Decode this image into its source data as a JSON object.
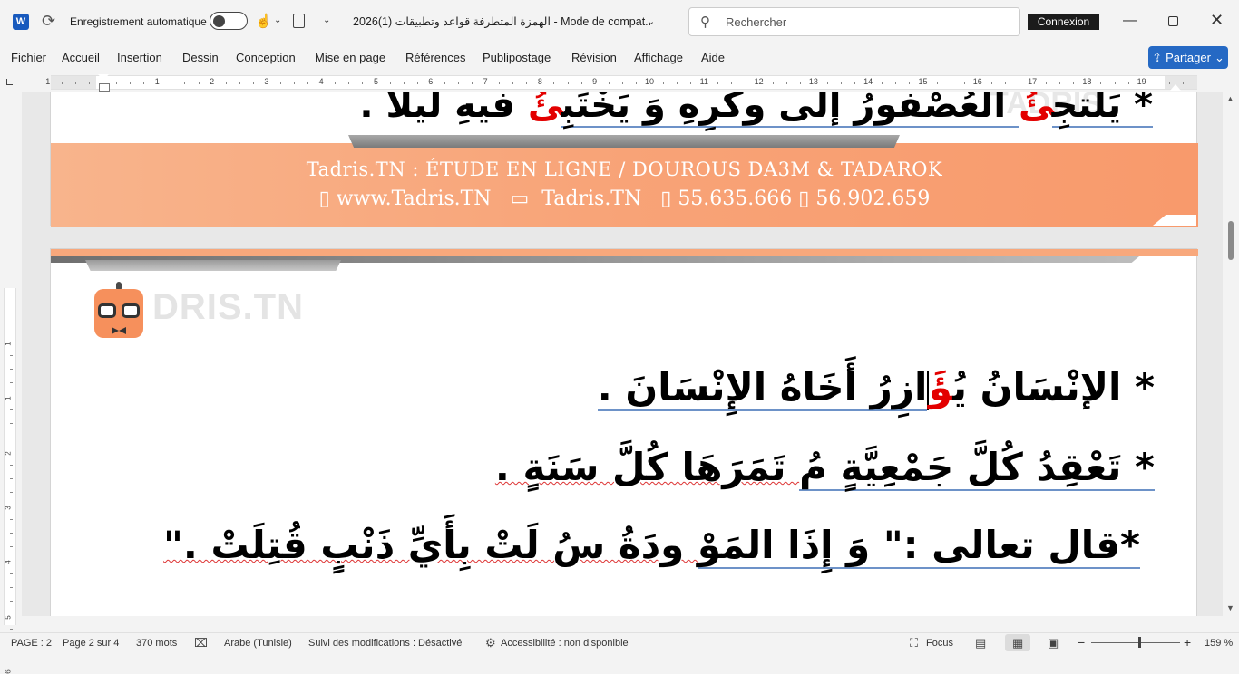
{
  "titlebar": {
    "app_logo": "W",
    "autosave_label": "Enregistrement automatique",
    "doc_title": "الهمزة المتطرفة  قواعد وتطبيقات (1)2026  -  Mode de compat...",
    "search_placeholder": "Rechercher",
    "connexion_label": "Connexion",
    "minimize_glyph": "—",
    "close_glyph": "✕"
  },
  "ribbon": {
    "tabs": [
      "Fichier",
      "Accueil",
      "Insertion",
      "Dessin",
      "Conception",
      "Mise en page",
      "Références",
      "Publipostage",
      "Révision",
      "Affichage",
      "Aide"
    ],
    "share_label": "Partager"
  },
  "ruler": {
    "numbers": [
      "2",
      "1",
      "1",
      "2",
      "3",
      "4",
      "5",
      "6",
      "7",
      "8",
      "9",
      "10",
      "11",
      "12",
      "13",
      "14",
      "15",
      "16",
      "17",
      "18",
      "19"
    ]
  },
  "vruler": {
    "numbers": [
      "1",
      "1",
      "2",
      "3",
      "4",
      "5",
      "6"
    ]
  },
  "page1": {
    "line": {
      "p1": "* يَلتجِ",
      "red1": "ئُ",
      "p2": " العُصْفورُ إلى وكْرِهِ وَ يَخْتَبِ",
      "red2": "ئُ",
      "p3": "  فيهِ ليلاً ."
    },
    "watermark": "TADRIS",
    "footer_line1": "Tadris.TN : ÉTUDE EN LIGNE / DOUROUS DA3M & TADAROK",
    "footer_line2": "▯ www.Tadris.TN   ▭  Tadris.TN   ▯ 55.635.666 ▯ 56.902.659"
  },
  "page2": {
    "watermark": "DRIS.TN",
    "line1": {
      "p1": "* الإنْسَانُ يُ",
      "red": "ؤَ",
      "p2": "ازِرُ أَخَاهُ الإِنْسَانَ ."
    },
    "line2": {
      "p1": "* تَعْقِدُ كُلَّ جَمْعِيَّةٍ  مُ",
      "p2": "    تَمَرَهَا كُلَّ سَنَةٍ ."
    },
    "line3": {
      "p1": "*قال تعالى :\" وَ إِذَا المَوْ",
      "p2": "  ودَةُ سُ لَتْ بِأَيِّ ذَنْبٍ قُتِلَتْ .\""
    }
  },
  "statusbar": {
    "page": "PAGE : 2",
    "page_of": "Page 2 sur 4",
    "words": "370 mots",
    "language": "Arabe (Tunisie)",
    "tracking": "Suivi des modifications : Désactivé",
    "accessibility": "Accessibilité : non disponible",
    "focus": "Focus",
    "zoom_minus": "−",
    "zoom_plus": "+",
    "zoom": "159 %",
    "zoom_fraction": 0.54
  },
  "colors": {
    "accent": "#2569c4",
    "word_blue": "#185abd",
    "orange_band": "#f8a377",
    "highlight_red": "#e30000"
  },
  "icons": [
    "word-app-icon",
    "refresh-icon",
    "touch-mode-icon",
    "clipboard-icon",
    "search-icon",
    "share-icon",
    "proofing-icon",
    "accessibility-icon",
    "focus-icon",
    "read-mode-icon",
    "print-layout-icon",
    "web-layout-icon"
  ]
}
